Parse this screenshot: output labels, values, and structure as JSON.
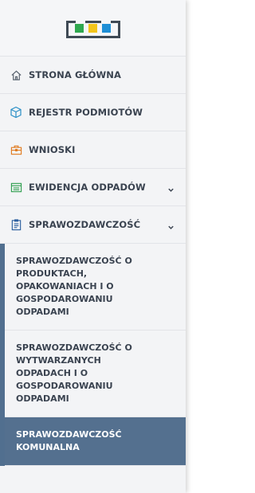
{
  "logo": {
    "colors": [
      "#2fa84f",
      "#f3c51a",
      "#1f8fd6"
    ]
  },
  "nav": [
    {
      "label": "STRONA GŁÓWNA",
      "icon": "home-icon",
      "color": "#5a6470"
    },
    {
      "label": "REJESTR PODMIOTÓW",
      "icon": "cube-icon",
      "color": "#2a8fc6"
    },
    {
      "label": "WNIOSKI",
      "icon": "briefcase-icon",
      "color": "#e07b1f"
    },
    {
      "label": "EWIDENCJA ODPADÓW",
      "icon": "document-list-icon",
      "color": "#2e9e4e",
      "expandable": true
    },
    {
      "label": "SPRAWOZDAWCZOŚĆ",
      "icon": "clipboard-icon",
      "color": "#2a5e9e",
      "expandable": true
    }
  ],
  "submenu": [
    {
      "label": "SPRAWOZDAWCZOŚĆ O PRODUKTACH, OPAKOWANIACH I O GOSPODAROWANIU ODPADAMI",
      "lines": [
        "SPRAWOZDAWCZOŚĆ O",
        "PRODUKTACH,",
        "OPAKOWANIACH I O",
        "GOSPODAROWANIU",
        "ODPADAMI"
      ]
    },
    {
      "label": "SPRAWOZDAWCZOŚĆ O WYTWARZANYCH ODPADACH I O GOSPODAROWANIU ODPADAMI",
      "lines": [
        "SPRAWOZDAWCZOŚĆ O",
        "WYTWARZANYCH",
        "ODPADACH I O",
        "GOSPODAROWANIU",
        "ODPADAMI"
      ]
    },
    {
      "label": "SPRAWOZDAWCZOŚĆ KOMUNALNA",
      "lines": [
        "SPRAWOZDAWCZOŚĆ",
        "KOMUNALNA"
      ],
      "active": true
    }
  ]
}
